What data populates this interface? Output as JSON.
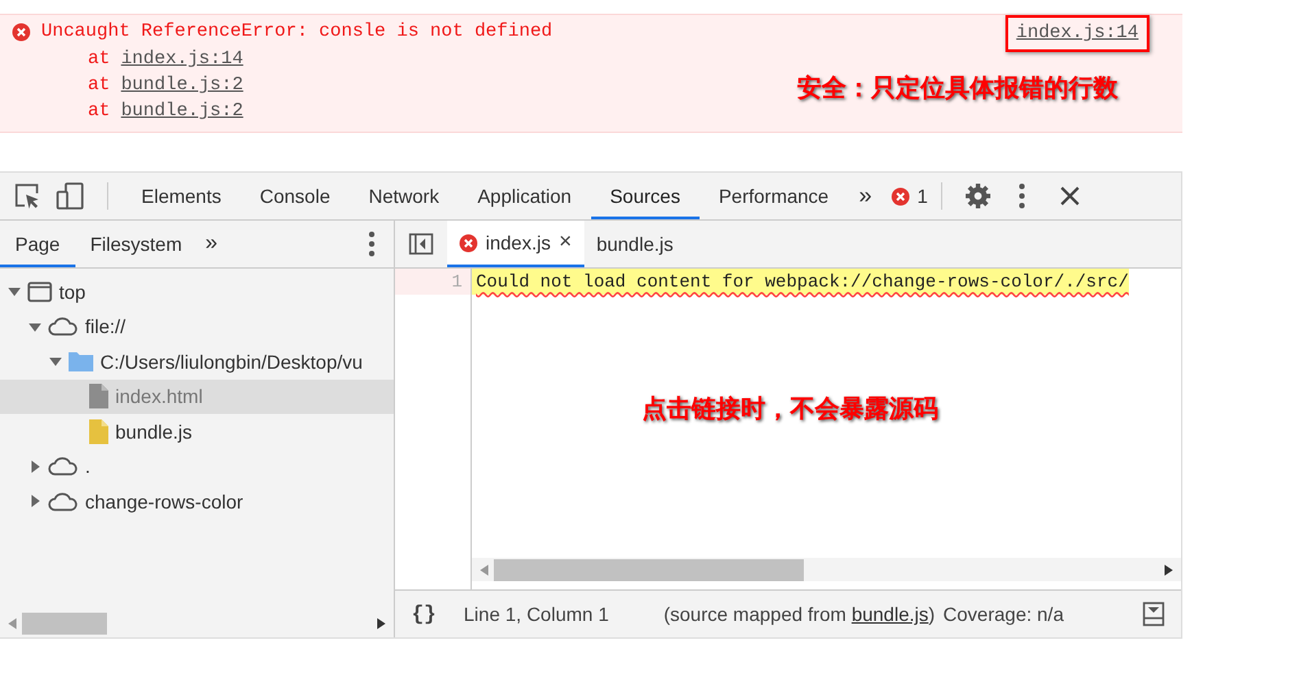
{
  "console_error": {
    "message": "Uncaught ReferenceError: consle is not defined",
    "source_link": "index.js:14",
    "highlighted": true,
    "stack": [
      {
        "prefix": "at",
        "link": "index.js:14"
      },
      {
        "prefix": "at",
        "link": "bundle.js:2"
      },
      {
        "prefix": "at",
        "link": "bundle.js:2"
      }
    ]
  },
  "annotations": [
    {
      "text": "安全：只定位具体报错的行数"
    },
    {
      "text": "点击链接时，不会暴露源码"
    }
  ],
  "toolbar": {
    "tabs": [
      {
        "label": "Elements",
        "selected": false
      },
      {
        "label": "Console",
        "selected": false
      },
      {
        "label": "Network",
        "selected": false
      },
      {
        "label": "Application",
        "selected": false
      },
      {
        "label": "Sources",
        "selected": true
      },
      {
        "label": "Performance",
        "selected": false
      }
    ],
    "overflow": "»",
    "error_count": "1"
  },
  "navigator": {
    "tabs": [
      {
        "label": "Page",
        "selected": true
      },
      {
        "label": "Filesystem",
        "selected": false
      }
    ],
    "overflow": "»",
    "tree": [
      {
        "label": "top",
        "kind": "frame",
        "expanded": true,
        "selected": false,
        "children": [
          {
            "label": "file://",
            "kind": "origin",
            "expanded": true,
            "selected": false,
            "children": [
              {
                "label": "C:/Users/liulongbin/Desktop/vu",
                "kind": "folder",
                "expanded": true,
                "selected": false,
                "children": [
                  {
                    "label": "index.html",
                    "kind": "document",
                    "selected": true
                  },
                  {
                    "label": "bundle.js",
                    "kind": "script",
                    "selected": false
                  }
                ]
              }
            ]
          },
          {
            "label": ".",
            "kind": "origin",
            "expanded": false,
            "selected": false
          },
          {
            "label": "change-rows-color",
            "kind": "origin",
            "expanded": false,
            "selected": false
          }
        ]
      }
    ]
  },
  "editor": {
    "tabs": [
      {
        "label": "index.js",
        "error": true,
        "close": "×",
        "selected": true
      },
      {
        "label": "bundle.js",
        "error": false,
        "selected": false
      }
    ],
    "lines": [
      {
        "number": "1",
        "text": "Could not load content for webpack://change-rows-color/./src/",
        "warning": true
      }
    ]
  },
  "status_bar": {
    "format": "{}",
    "position": "Line 1, Column 1",
    "source_prefix": "(source mapped from ",
    "source_link": "bundle.js",
    "source_suffix": ")",
    "coverage": "Coverage: n/a"
  }
}
